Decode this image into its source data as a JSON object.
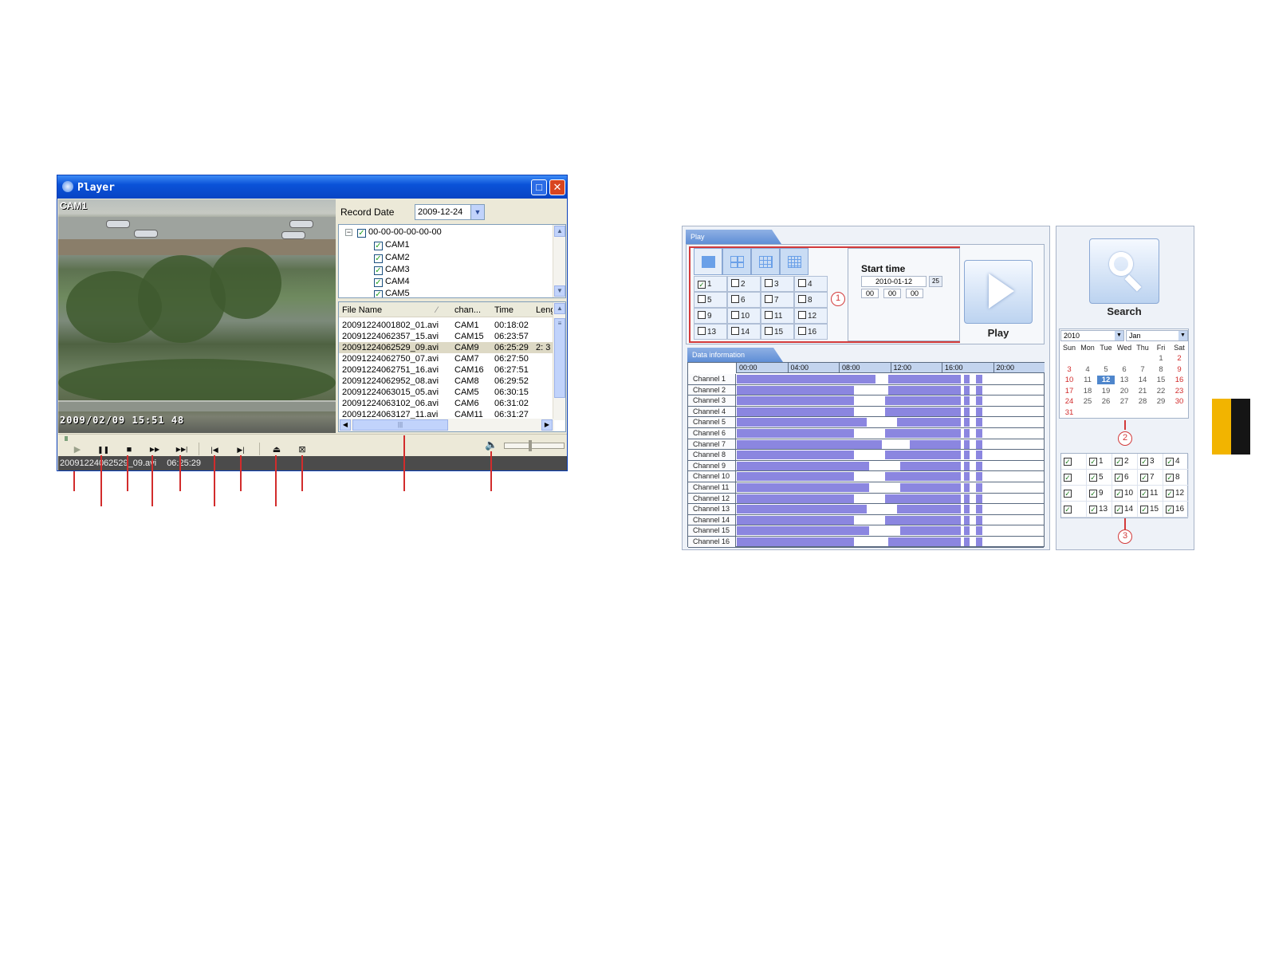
{
  "player": {
    "title": "Player",
    "window_icons": {
      "maximize": "maximize-icon",
      "close": "close-icon",
      "close_glyph": "✕",
      "max_glyph": "□"
    },
    "video": {
      "cam_label": "CAM1",
      "osd_timestamp": "2009/02/09 15:51 48"
    },
    "record_date_label": "Record Date",
    "record_date_value": "2009-12-24",
    "tree": {
      "root": "00-00-00-00-00-00",
      "cams": [
        "CAM1",
        "CAM2",
        "CAM3",
        "CAM4",
        "CAM5"
      ]
    },
    "file_list": {
      "columns": [
        "File Name",
        "chan...",
        "Time",
        "Leng"
      ],
      "rows": [
        {
          "name": "20091224001802_01.avi",
          "chan": "CAM1",
          "time": "00:18:02",
          "len": ""
        },
        {
          "name": "20091224062357_15.avi",
          "chan": "CAM15",
          "time": "06:23:57",
          "len": ""
        },
        {
          "name": "20091224062529_09.avi",
          "chan": "CAM9",
          "time": "06:25:29",
          "len": "2: 3"
        },
        {
          "name": "20091224062750_07.avi",
          "chan": "CAM7",
          "time": "06:27:50",
          "len": ""
        },
        {
          "name": "20091224062751_16.avi",
          "chan": "CAM16",
          "time": "06:27:51",
          "len": ""
        },
        {
          "name": "20091224062952_08.avi",
          "chan": "CAM8",
          "time": "06:29:52",
          "len": ""
        },
        {
          "name": "20091224063015_05.avi",
          "chan": "CAM5",
          "time": "06:30:15",
          "len": ""
        },
        {
          "name": "20091224063102_06.avi",
          "chan": "CAM6",
          "time": "06:31:02",
          "len": ""
        },
        {
          "name": "20091224063127_11.avi",
          "chan": "CAM11",
          "time": "06:31:27",
          "len": ""
        }
      ]
    },
    "status": {
      "file": "20091224062529_09.avi",
      "time": "06:25:29"
    },
    "controls": {
      "play": "▶",
      "pause": "❚❚",
      "stop": "■",
      "fast_forward": "▶▶",
      "next_frame": "▶▶|",
      "previous_file": "|◀",
      "next_file": "▶|",
      "snapshot": "⏏",
      "fullscreen": "⊠",
      "volume": "🔈"
    }
  },
  "play_panel": {
    "tab_label": "Play",
    "channels": [
      "1",
      "2",
      "3",
      "4",
      "5",
      "6",
      "7",
      "8",
      "9",
      "10",
      "11",
      "12",
      "13",
      "14",
      "15",
      "16"
    ],
    "callout_1": "1",
    "start_time_label": "Start time",
    "start_date": "2010-01-12",
    "calendar_btn": "25",
    "start_hh": "00",
    "start_mm": "00",
    "start_ss": "00",
    "play_label": "Play"
  },
  "data_info": {
    "tab_label": "Data information",
    "time_ticks": [
      "00:00",
      "04:00",
      "08:00",
      "12:00",
      "16:00",
      "20:00"
    ],
    "channels": [
      "Channel 1",
      "Channel 2",
      "Channel 3",
      "Channel 4",
      "Channel 5",
      "Channel 6",
      "Channel 7",
      "Channel 8",
      "Channel 9",
      "Channel 10",
      "Channel 11",
      "Channel 12",
      "Channel 13",
      "Channel 14",
      "Channel 15",
      "Channel 16"
    ],
    "bar_color": "#8b86e0"
  },
  "search_panel": {
    "search_label": "Search",
    "year": "2010",
    "month": "Jan",
    "weekdays": [
      "Sun",
      "Mon",
      "Tue",
      "Wed",
      "Thu",
      "Fri",
      "Sat"
    ],
    "days": [
      "1",
      "2",
      "3",
      "4",
      "5",
      "6",
      "7",
      "8",
      "9",
      "10",
      "11",
      "12",
      "13",
      "14",
      "15",
      "16",
      "17",
      "18",
      "19",
      "20",
      "21",
      "22",
      "23",
      "24",
      "25",
      "26",
      "27",
      "28",
      "29",
      "30",
      "31"
    ],
    "selected_day": "12",
    "callout_2": "2",
    "channels": [
      "",
      "1",
      "2",
      "3",
      "4",
      "",
      "5",
      "6",
      "7",
      "8",
      "",
      "9",
      "10",
      "11",
      "12",
      "",
      "13",
      "14",
      "15",
      "16"
    ],
    "callout_3": "3"
  }
}
